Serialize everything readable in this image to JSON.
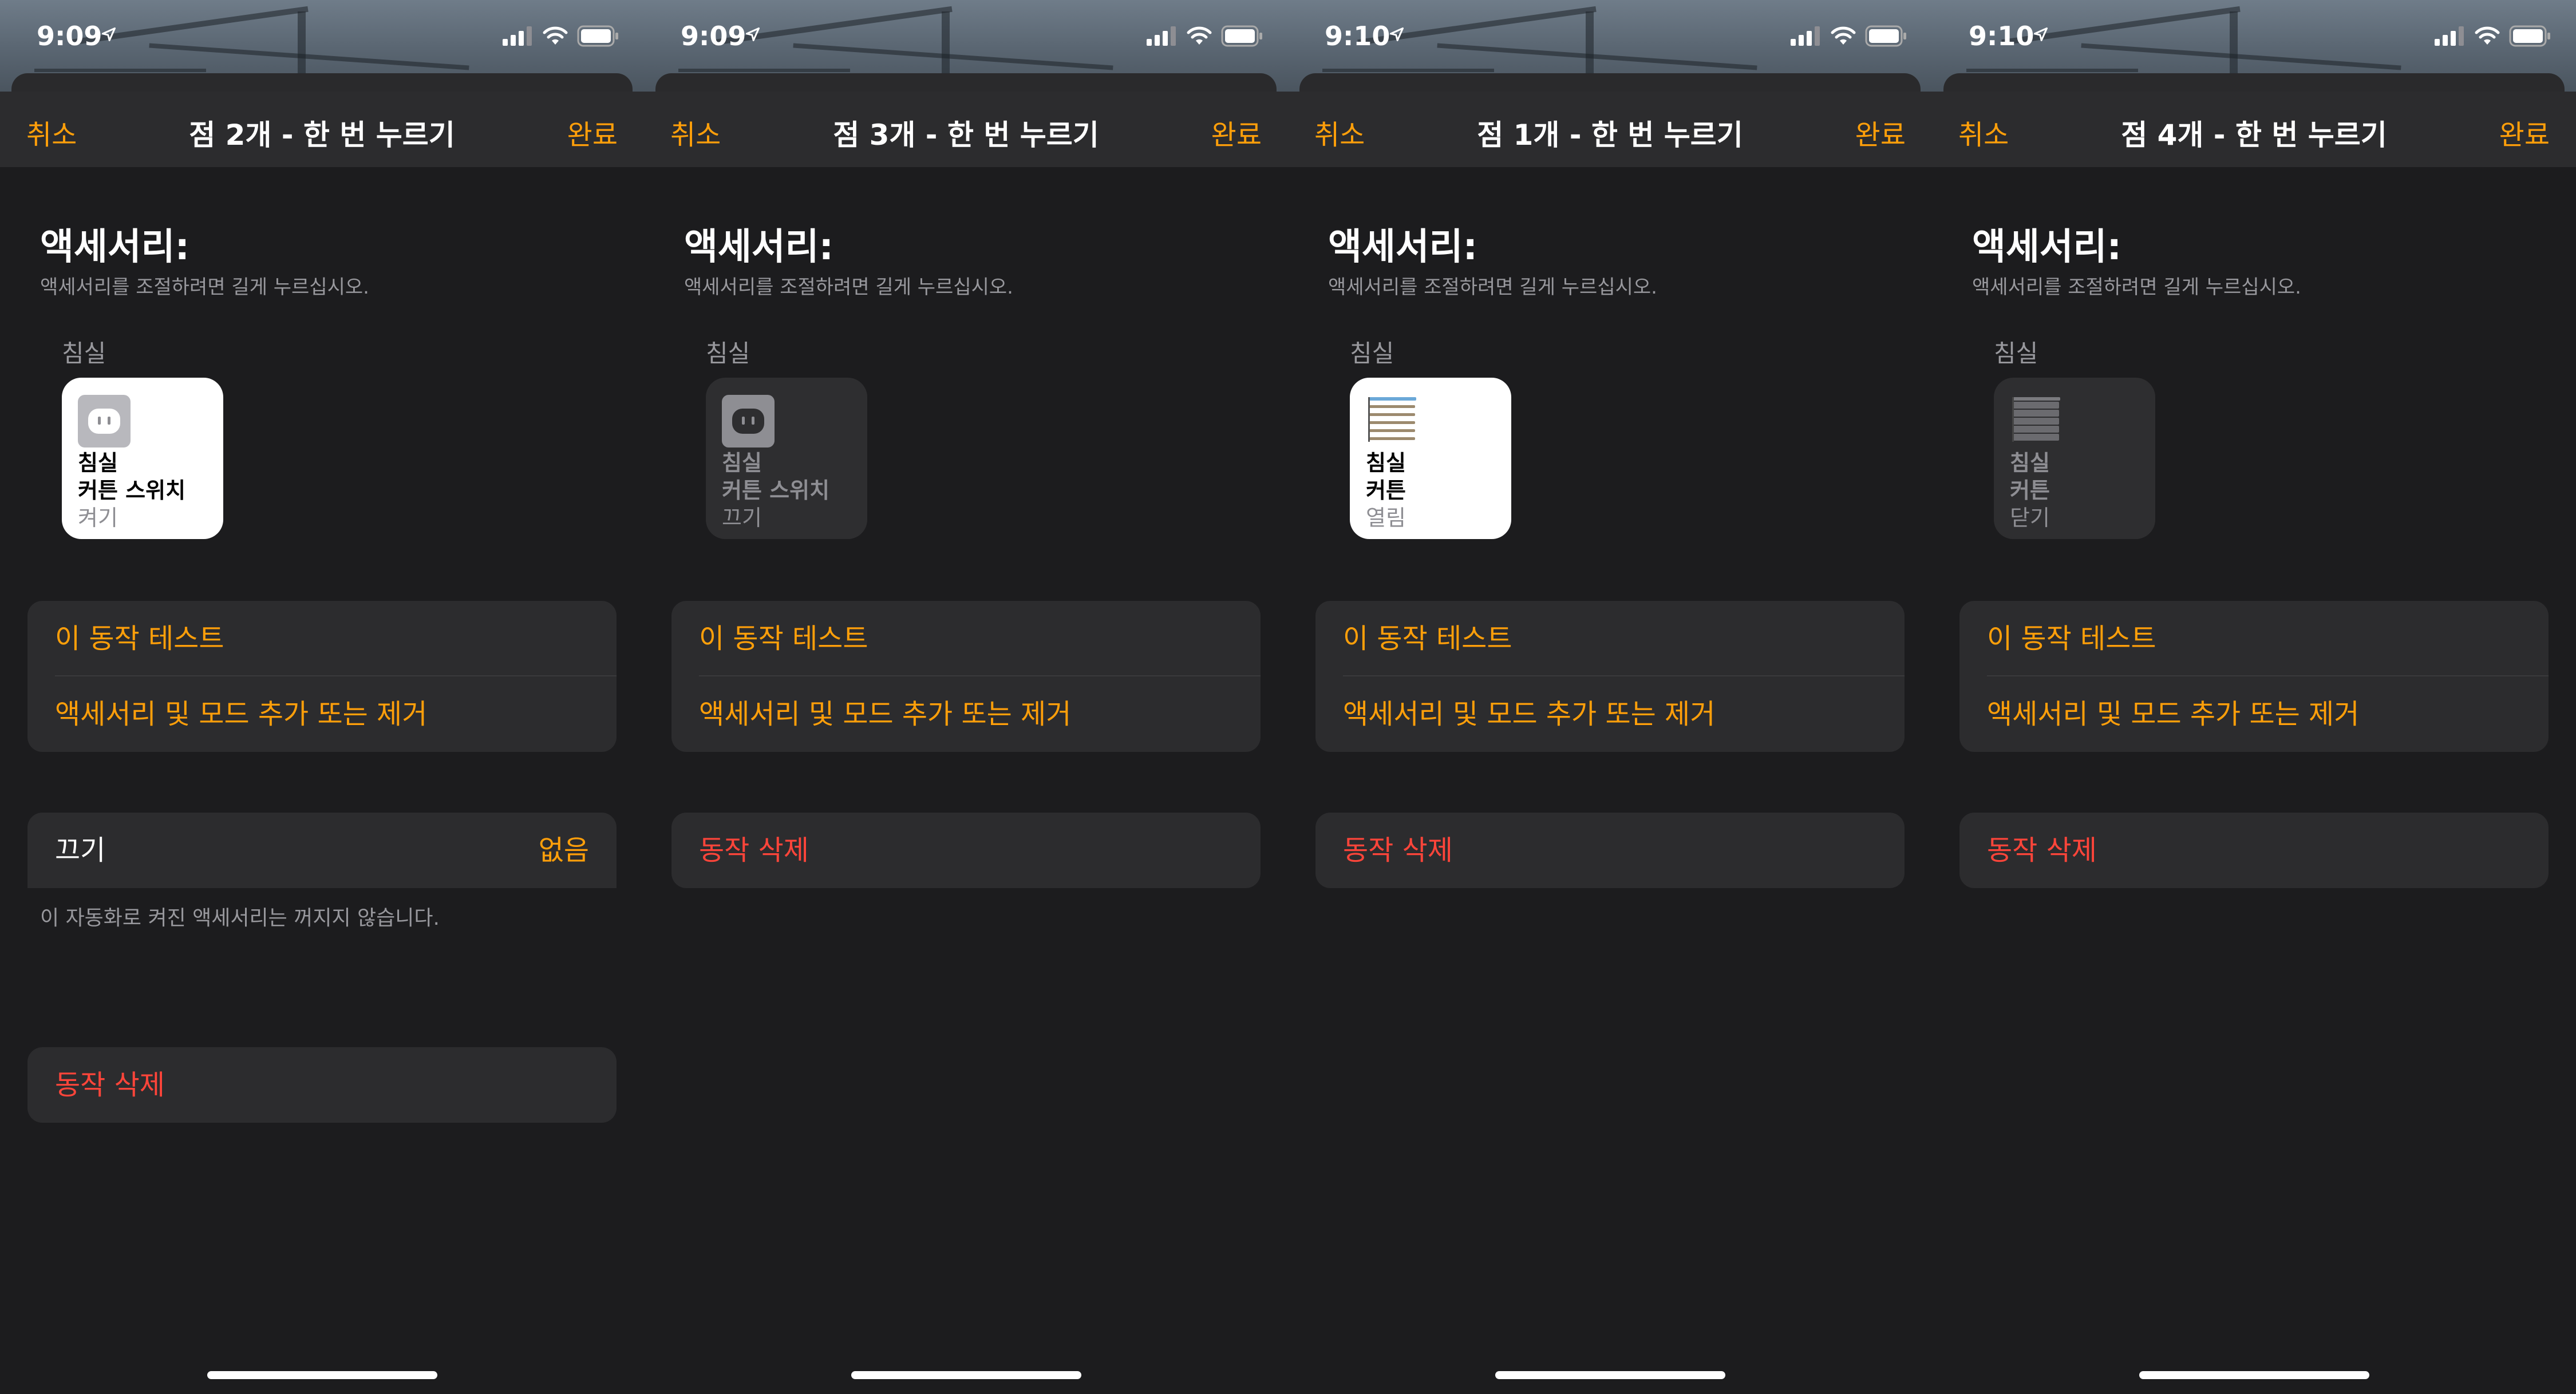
{
  "panels": [
    {
      "status_time": "9:09",
      "nav": {
        "cancel": "취소",
        "title": "점 2개 - 한 번 누르기",
        "done": "완료"
      },
      "accessories": {
        "title": "액세서리:",
        "subtitle": "액세서리를 조절하려면 길게 누르십시오."
      },
      "room": "침실",
      "tile": {
        "room": "침실",
        "name": "커튼 스위치",
        "state": "켜기",
        "icon": "outlet-icon",
        "active": true
      },
      "actions": {
        "test": "이 동작 테스트",
        "edit": "액세서리 및 모드 추가 또는 제거"
      },
      "turn_off": {
        "label": "끄기",
        "value": "없음",
        "note": "이 자동화로 켜진 액세서리는 꺼지지 않습니다."
      },
      "delete": "동작 삭제"
    },
    {
      "status_time": "9:09",
      "nav": {
        "cancel": "취소",
        "title": "점 3개 - 한 번 누르기",
        "done": "완료"
      },
      "accessories": {
        "title": "액세서리:",
        "subtitle": "액세서리를 조절하려면 길게 누르십시오."
      },
      "room": "침실",
      "tile": {
        "room": "침실",
        "name": "커튼 스위치",
        "state": "끄기",
        "icon": "outlet-icon",
        "active": false
      },
      "actions": {
        "test": "이 동작 테스트",
        "edit": "액세서리 및 모드 추가 또는 제거"
      },
      "delete": "동작 삭제"
    },
    {
      "status_time": "9:10",
      "nav": {
        "cancel": "취소",
        "title": "점 1개 - 한 번 누르기",
        "done": "완료"
      },
      "accessories": {
        "title": "액세서리:",
        "subtitle": "액세서리를 조절하려면 길게 누르십시오."
      },
      "room": "침실",
      "tile": {
        "room": "침실",
        "name": "커튼",
        "state": "열림",
        "icon": "blinds-open-icon",
        "active": true
      },
      "actions": {
        "test": "이 동작 테스트",
        "edit": "액세서리 및 모드 추가 또는 제거"
      },
      "delete": "동작 삭제"
    },
    {
      "status_time": "9:10",
      "nav": {
        "cancel": "취소",
        "title": "점 4개 - 한 번 누르기",
        "done": "완료"
      },
      "accessories": {
        "title": "액세서리:",
        "subtitle": "액세서리를 조절하려면 길게 누르십시오."
      },
      "room": "침실",
      "tile": {
        "room": "침실",
        "name": "커튼",
        "state": "닫기",
        "icon": "blinds-closed-icon",
        "active": false
      },
      "actions": {
        "test": "이 동작 테스트",
        "edit": "액세서리 및 모드 추가 또는 제거"
      },
      "delete": "동작 삭제"
    }
  ],
  "colors": {
    "accent": "#ff9f0a",
    "destructive": "#ff453a",
    "background": "#1c1c1e",
    "cell": "#2c2c2e"
  }
}
